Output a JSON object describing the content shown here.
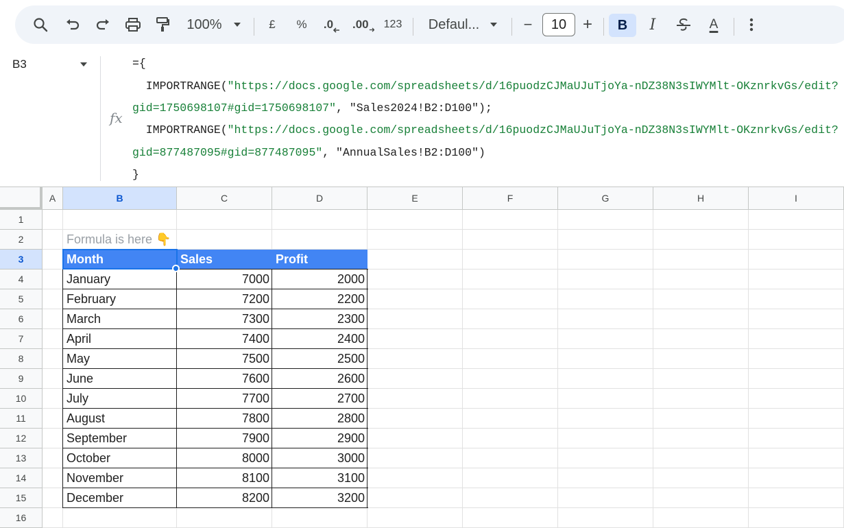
{
  "toolbar": {
    "zoom": "100%",
    "currency": "£",
    "percent": "%",
    "decrease_decimal": ".0",
    "increase_decimal": ".00",
    "more_formats": "123",
    "font": "Defaul...",
    "minus": "−",
    "font_size": "10",
    "plus": "+",
    "bold": "B",
    "italic": "I",
    "text_color": "A",
    "icons": [
      "search-icon",
      "undo-icon",
      "redo-icon",
      "print-icon",
      "paint-format-icon",
      "chevron-down-icon",
      "strikethrough-icon",
      "more-vert-icon"
    ]
  },
  "formula_bar": {
    "cell_ref": "B3",
    "fx": "fx",
    "lines": [
      {
        "code": "={",
        "str": "",
        "tail": ""
      },
      {
        "code": "  IMPORTRANGE(",
        "str": "\"https://docs.google.com/spreadsheets/d/16puodzCJMaUJuTjoYa-nDZ38N3sIWYMlt-OKznrkvGs/edit?",
        "tail": ""
      },
      {
        "code": "",
        "str": "gid=1750698107#gid=1750698107\"",
        "tail": ", \"Sales2024!B2:D100\");"
      },
      {
        "code": "  IMPORTRANGE(",
        "str": "\"https://docs.google.com/spreadsheets/d/16puodzCJMaUJuTjoYa-nDZ38N3sIWYMlt-OKznrkvGs/edit?",
        "tail": ""
      },
      {
        "code": "",
        "str": "gid=877487095#gid=877487095\"",
        "tail": ", \"AnnualSales!B2:D100\")"
      },
      {
        "code": "}",
        "str": "",
        "tail": ""
      }
    ]
  },
  "grid": {
    "columns": [
      "A",
      "B",
      "C",
      "D",
      "E",
      "F",
      "G",
      "H",
      "I"
    ],
    "selected_column": "B",
    "rows": [
      "1",
      "2",
      "3",
      "4",
      "5",
      "6",
      "7",
      "8",
      "9",
      "10",
      "11",
      "12",
      "13",
      "14",
      "15",
      "16"
    ],
    "selected_row": "3",
    "hint": "Formula is here 👇",
    "headers": [
      "Month",
      "Sales",
      "Profit"
    ],
    "data": [
      [
        "January",
        "7000",
        "2000"
      ],
      [
        "February",
        "7200",
        "2200"
      ],
      [
        "March",
        "7300",
        "2300"
      ],
      [
        "April",
        "7400",
        "2400"
      ],
      [
        "May",
        "7500",
        "2500"
      ],
      [
        "June",
        "7600",
        "2600"
      ],
      [
        "July",
        "7700",
        "2700"
      ],
      [
        "August",
        "7800",
        "2800"
      ],
      [
        "September",
        "7900",
        "2900"
      ],
      [
        "October",
        "8000",
        "3000"
      ],
      [
        "November",
        "8100",
        "3100"
      ],
      [
        "December",
        "8200",
        "3200"
      ]
    ],
    "colors": {
      "header_fill": "#4285f4",
      "selection": "#1a73e8",
      "hint": "#9aa0a6",
      "string": "#188038"
    }
  }
}
